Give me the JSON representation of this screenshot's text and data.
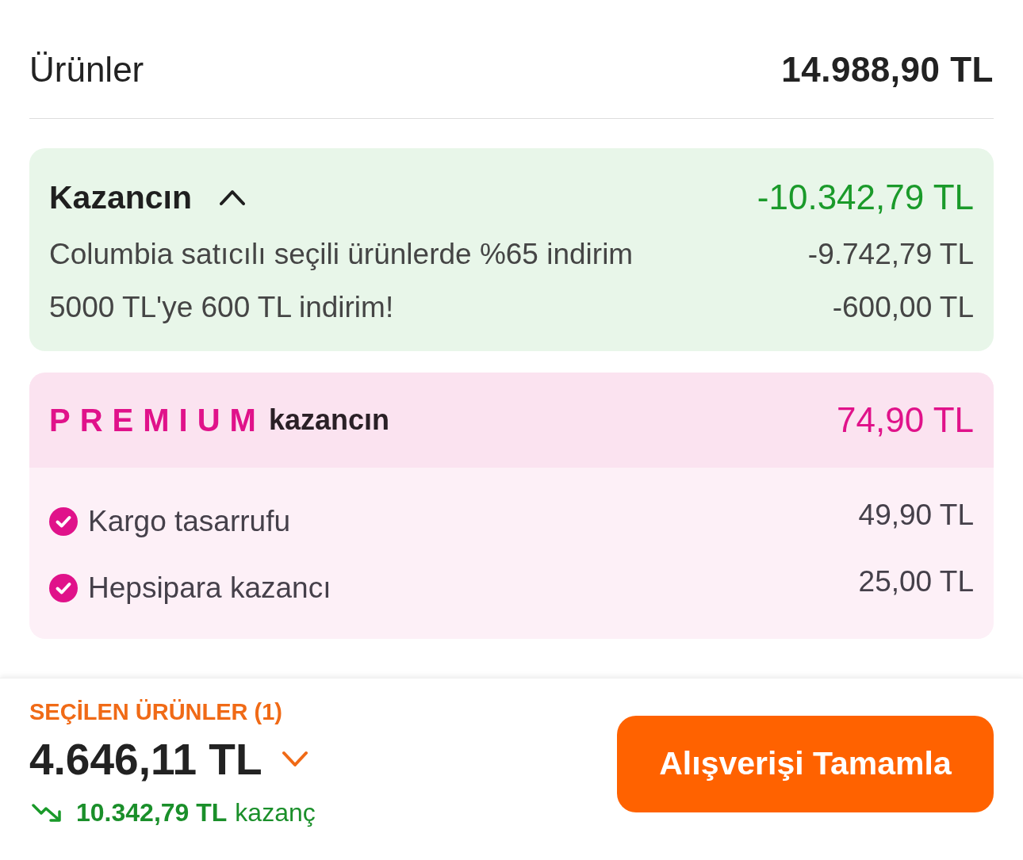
{
  "summary": {
    "label": "Ürünler",
    "value": "14.988,90 TL"
  },
  "savings": {
    "title": "Kazancın",
    "expanded": true,
    "total": "-10.342,79 TL",
    "items": [
      {
        "label": "Columbia satıcılı seçili ürünlerde %65 indirim",
        "value": "-9.742,79 TL"
      },
      {
        "label": "5000 TL'ye 600 TL indirim!",
        "value": "-600,00 TL"
      }
    ]
  },
  "premium": {
    "brand": "PREMIUM",
    "title": "kazancın",
    "total": "74,90 TL",
    "items": [
      {
        "label": "Kargo tasarrufu",
        "value": "49,90 TL",
        "checked": true
      },
      {
        "label": "Hepsipara kazancı",
        "value": "25,00 TL",
        "checked": true
      }
    ]
  },
  "footer": {
    "selected_label": "SEÇİLEN ÜRÜNLER (1)",
    "total": "4.646,11 TL",
    "expanded": false,
    "savings_amount": "10.342,79 TL",
    "savings_suffix": "kazanç",
    "checkout_button": "Alışverişi Tamamla"
  }
}
